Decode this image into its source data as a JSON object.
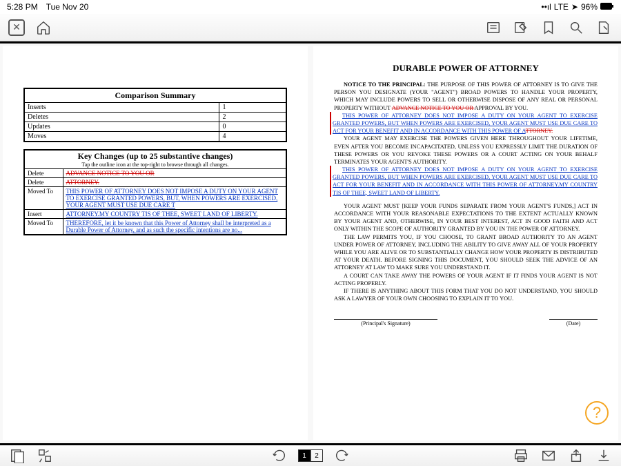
{
  "status": {
    "time": "5:28 PM",
    "date": "Tue Nov 20",
    "carrier": "LTE",
    "batt": "96%",
    "loc_icon": "location-icon",
    "batt_icon": "battery-icon",
    "sig_icon": "signal-icon"
  },
  "comparison": {
    "title": "Comparison Summary",
    "rows": [
      {
        "label": "Inserts",
        "value": "1"
      },
      {
        "label": "Deletes",
        "value": "2"
      },
      {
        "label": "Updates",
        "value": "0"
      },
      {
        "label": "Moves",
        "value": "4"
      }
    ]
  },
  "keychanges": {
    "title": "Key Changes (up to 25 substantive changes)",
    "subtitle": "Tap the outline icon at the top-right to browse through all changes.",
    "rows": [
      {
        "label": "Delete",
        "content": "ADVANCE NOTICE TO YOU OR",
        "cls": "strike-red"
      },
      {
        "label": "Delete",
        "content": "ATTORNEY.",
        "cls": "strike-red"
      },
      {
        "label": "Moved To",
        "content": "THIS POWER OF ATTORNEY DOES NOT IMPOSE A DUTY ON YOUR AGENT TO EXERCISE GRANTED POWERS, BUT, WHEN POWERS ARE EXERCISED, YOUR AGENT MUST USE DUE CARE T",
        "cls": "blue-u"
      },
      {
        "label": "Insert",
        "content": "ATTORNEY.MY COUNTRY TIS OF THEE, SWEET LAND OF LIBERTY.",
        "cls": "blue-u"
      },
      {
        "label": "Moved To",
        "content": "THEREFORE, let it be known that this Power of Attorney shall be interpreted as a Durable Power of Attorney, and as such the specific intentions are no...",
        "cls": "blue-u"
      }
    ]
  },
  "doc": {
    "title": "DURABLE POWER OF ATTORNEY",
    "notice_label": "NOTICE TO THE PRINCIPAL:",
    "p1a": " THE PURPOSE OF THIS POWER OF ATTORNEY IS TO GIVE THE PERSON YOU DESIGNATE (YOUR \"AGENT\") BROAD POWERS TO HANDLE YOUR PROPERTY, WHICH MAY INCLUDE POWERS TO SELL OR OTHERWISE DISPOSE OF ANY REAL OR PERSONAL PROPERTY WITHOUT ",
    "p1_strike": "ADVANCE NOTICE TO YOU OR ",
    "p1b": "APPROVAL BY YOU.",
    "p2a": "THIS POWER OF ATTORNEY DOES NOT IMPOSE A DUTY ON YOUR AGENT TO EXERCISE GRANTED POWERS, BUT WHEN POWERS ARE EXERCISED, YOUR AGENT MUST USE DUE CARE TO ACT FOR YOUR BENEFIT AND IN ACCORDANCE WITH THIS POWER OF A",
    "p2_strike": "TTORNEY.",
    "p3": "YOUR AGENT MAY EXERCISE THE POWERS GIVEN HERE THROUGHOUT YOUR LIFETIME, EVEN AFTER YOU BECOME INCAPACITATED, UNLESS YOU EXPRESSLY LIMIT THE DURATION OF THESE POWERS OR YOU REVOKE THESE POWERS OR A COURT ACTING ON YOUR BEHALF TERMINATES YOUR AGENT'S AUTHORITY.",
    "p4a": "THIS POWER OF ATTORNEY DOES NOT IMPOSE A DUTY ON YOUR AGENT TO EXERCISE GRANTED POWERS, BUT WHEN POWERS ARE EXERCISED, YOUR AGENT MUST USE DUE CARE TO ACT FOR YOUR BENEFIT AND IN ACCORDANCE WITH THIS POWER OF ",
    "p4b": "ATTORNEY.MY COUNTRY TIS OF THEE, SWEET LAND OF LIBERTY.",
    "p5": "YOUR AGENT MUST [KEEP YOUR FUNDS SEPARATE FROM YOUR AGENT'S FUNDS,] ACT IN ACCORDANCE WITH YOUR REASONABLE EXPECTATIONS TO THE EXTENT ACTUALLY KNOWN BY YOUR AGENT AND, OTHERWISE, IN YOUR BEST INTEREST, ACT IN GOOD FAITH AND ACT ONLY WITHIN THE SCOPE OF AUTHORITY GRANTED BY YOU IN THE POWER OF ATTORNEY.",
    "p6": "THE LAW PERMITS YOU, IF YOU CHOOSE, TO GRANT BROAD AUTHORITY TO AN AGENT UNDER POWER OF ATTORNEY, INCLUDING THE ABILITY TO GIVE AWAY ALL OF YOUR PROPERTY WHILE YOU ARE ALIVE OR TO SUBSTANTIALLY CHANGE HOW YOUR PROPERTY IS DISTRIBUTED AT YOUR DEATH. BEFORE SIGNING THIS DOCUMENT, YOU SHOULD SEEK THE ADVICE OF AN ATTORNEY AT LAW TO MAKE SURE YOU UNDERSTAND IT.",
    "p7": "A COURT CAN TAKE AWAY THE POWERS OF YOUR AGENT IF IT FINDS YOUR AGENT IS NOT ACTING PROPERLY.",
    "p8": "IF THERE IS ANYTHING ABOUT THIS FORM THAT YOU DO NOT UNDERSTAND, YOU SHOULD ASK A LAWYER OF YOUR OWN CHOOSING TO EXPLAIN IT TO YOU.",
    "sig1": "(Principal's Signature)",
    "sig2": "(Date)"
  },
  "nav": {
    "page1": "1",
    "page2": "2"
  },
  "help": "?"
}
